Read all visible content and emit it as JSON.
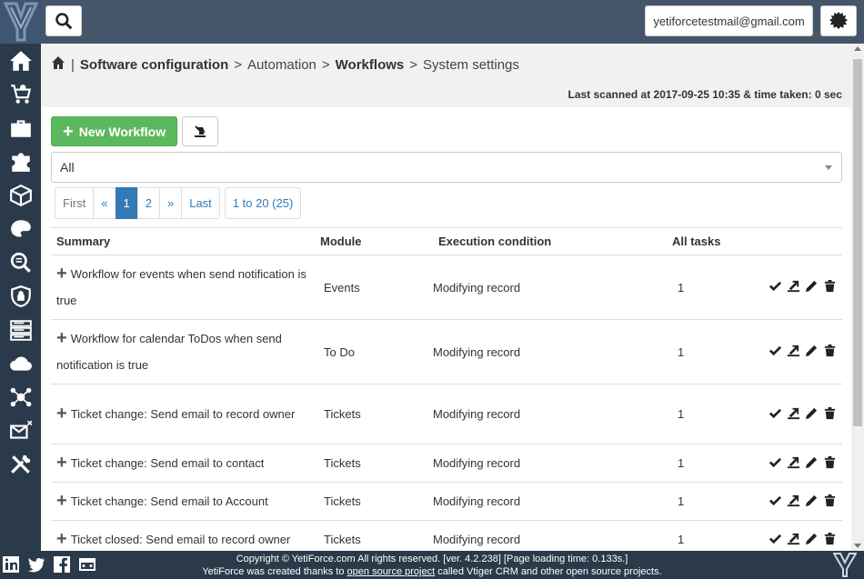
{
  "header": {
    "user_email": "yetiforcetestmail@gmail.com"
  },
  "sidebar": {
    "items": [
      {
        "icon": "home-icon"
      },
      {
        "icon": "cart-icon"
      },
      {
        "icon": "briefcase-icon"
      },
      {
        "icon": "puzzle-icon"
      },
      {
        "icon": "cube-icon"
      },
      {
        "icon": "palette-icon"
      },
      {
        "icon": "search-list-icon"
      },
      {
        "icon": "shield-icon"
      },
      {
        "icon": "server-icon"
      },
      {
        "icon": "cloud-sync-icon"
      },
      {
        "icon": "network-icon"
      },
      {
        "icon": "mail-settings-icon"
      },
      {
        "icon": "tools-icon"
      }
    ]
  },
  "breadcrumb": {
    "sep": "|",
    "item1": "Software configuration",
    "gt1": ">",
    "item2": "Automation",
    "gt2": ">",
    "item3": "Workflows",
    "gt3": ">",
    "item4": "System settings"
  },
  "scan_info": "Last scanned at 2017-09-25 10:35 & time taken: 0 sec",
  "toolbar": {
    "new_workflow_label": "New Workflow"
  },
  "filter": {
    "selected": "All"
  },
  "pagination": {
    "first": "First",
    "prev": "«",
    "pages": [
      "1",
      "2"
    ],
    "next": "»",
    "last": "Last",
    "range": "1 to 20 (25)"
  },
  "table": {
    "headers": {
      "summary": "Summary",
      "module": "Module",
      "condition": "Execution condition",
      "tasks": "All tasks"
    },
    "rows": [
      {
        "summary": "Workflow for events when send notification is true",
        "module": "Events",
        "condition": "Modifying record",
        "tasks": "1"
      },
      {
        "summary": "Workflow for calendar ToDos when send notification is true",
        "module": "To Do",
        "condition": "Modifying record",
        "tasks": "1"
      },
      {
        "summary": "Ticket change: Send email to record owner",
        "module": "Tickets",
        "condition": "Modifying record",
        "tasks": "1"
      },
      {
        "summary": "Ticket change: Send email to contact",
        "module": "Tickets",
        "condition": "Modifying record",
        "tasks": "1"
      },
      {
        "summary": "Ticket change: Send email to Account",
        "module": "Tickets",
        "condition": "Modifying record",
        "tasks": "1"
      },
      {
        "summary": "Ticket closed: Send email to record owner",
        "module": "Tickets",
        "condition": "Modifying record",
        "tasks": "1"
      }
    ]
  },
  "footer": {
    "line1": "Copyright © YetiForce.com All rights reserved. [ver. 4.2.238] [Page loading time: 0.133s.]",
    "line2_a": "YetiForce was created thanks to ",
    "line2_link": "open source project",
    "line2_b": " called Vtiger CRM and other open source projects."
  },
  "colors": {
    "sidebar": "#2b3a4a",
    "header": "#46566a",
    "primary": "#337ab7",
    "success": "#5cb85c"
  }
}
